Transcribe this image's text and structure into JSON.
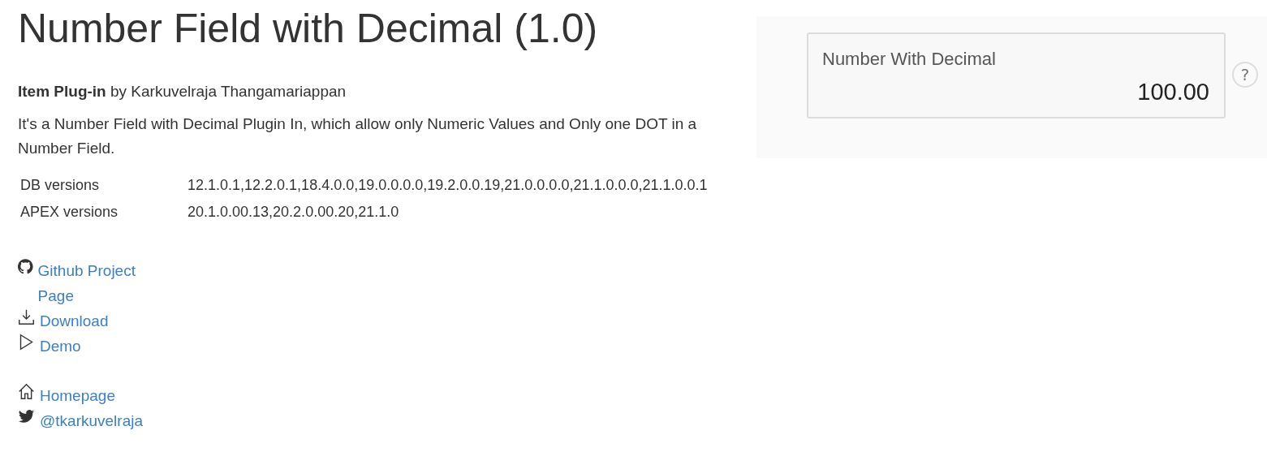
{
  "title": "Number Field with Decimal (1.0)",
  "byline": "**Item Plug-in** by Karkuvelraja Thangamariappan",
  "description": "It's a Number Field with Decimal Plugin In, which allow only Numeric Values and Only one DOT in a Number Field.",
  "versions": [
    {
      "label": "DB versions",
      "value": "12.1.0.1,12.2.0.1,18.4.0.0,19.0.0.0.0,19.2.0.0.19,21.0.0.0.0,21.1.0.0.0,21.1.0.0.1"
    },
    {
      "label": "APEX versions",
      "value": "20.1.0.00.13,20.2.0.00.20,21.1.0"
    }
  ],
  "link_groups": [
    [
      {
        "kind": "github",
        "label": "Github Project Page"
      },
      {
        "kind": "download",
        "label": "Download"
      },
      {
        "kind": "play",
        "label": "Demo"
      }
    ],
    [
      {
        "kind": "home",
        "label": "Homepage"
      },
      {
        "kind": "twitter",
        "label": "@tkarkuvelraja"
      }
    ]
  ],
  "preview": {
    "label": "Number With Decimal",
    "value": "100.00",
    "help": "?"
  }
}
